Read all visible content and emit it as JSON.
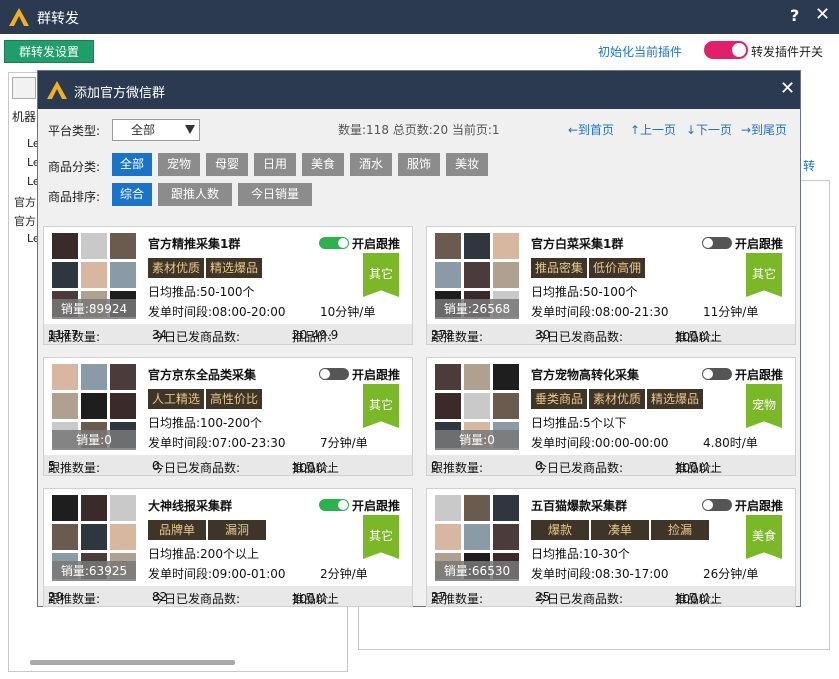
{
  "window": {
    "title": "群转发",
    "help": "?",
    "close": "✕"
  },
  "outer": {
    "settings_button": "群转发设置",
    "init_link": "初始化当前插件",
    "forward_switch_label": "转发插件开关",
    "forward_switch_on": true,
    "bg_tab": "机器",
    "bg_side_items": [
      "Le",
      "Le",
      "Le",
      "官方",
      "官方",
      "Le"
    ],
    "bg_right_link": "转"
  },
  "modal": {
    "title": "添加官方微信群",
    "close": "✕",
    "platform_label": "平台类型:",
    "platform_value": "全部",
    "stats": "数量:118 总页数:20 当前页:1",
    "nav": {
      "first": "←到首页",
      "prev": "↑上一页",
      "next": "↓下一页",
      "last": "→到尾页"
    },
    "category_label": "商品分类:",
    "categories": [
      "全部",
      "宠物",
      "母婴",
      "日用",
      "美食",
      "酒水",
      "服饰",
      "美妆"
    ],
    "sort_label": "商品排序:",
    "sorts": [
      "综合",
      "跟推人数",
      "今日销量"
    ]
  },
  "labels": {
    "follow": "开启跟推",
    "daily_prefix": "日均推品:",
    "time_prefix": "发单时间段:",
    "follow_count_prefix": "跟推数量:",
    "today_prefix": "今日已发商品数:",
    "price_prefix": "推品价:",
    "sales_prefix": "销量:"
  },
  "cards": [
    {
      "name": "官方精推采集1群",
      "enabled": true,
      "tags": [
        "素材优质",
        "精选爆品"
      ],
      "flag": "其它",
      "sales": "89924",
      "daily": "50-100个",
      "time": "08:00-20:00",
      "rate": "10分钟/单",
      "follow_count": "1177",
      "today": "34",
      "price": "20-49.9"
    },
    {
      "name": "官方白菜采集1群",
      "enabled": false,
      "tags": [
        "推品密集",
        "低价高佣"
      ],
      "flag": "其它",
      "sales": "26568",
      "daily": "50-100个",
      "time": "08:00-21:30",
      "rate": "11分钟/单",
      "follow_count": "272",
      "today": "30",
      "price": "100以上"
    },
    {
      "name": "官方京东全品类采集",
      "enabled": false,
      "tags": [
        "人工精选",
        "高性价比"
      ],
      "flag": "其它",
      "sales": "0",
      "daily": "100-200个",
      "time": "07:00-23:30",
      "rate": "7分钟/单",
      "follow_count": "5",
      "today": "0",
      "price": "100以上"
    },
    {
      "name": "官方宠物高转化采集",
      "enabled": false,
      "tags": [
        "垂类商品",
        "素材优质",
        "精选爆品"
      ],
      "flag": "宠物",
      "sales": "0",
      "daily": "5个以下",
      "time": "00:00-00:00",
      "rate": "4.80时/单",
      "follow_count": "0",
      "today": "0",
      "price": "100以上"
    },
    {
      "name": "大神线报采集群",
      "enabled": true,
      "tags": [
        "品牌单",
        "漏洞"
      ],
      "flag": "其它",
      "sales": "63925",
      "daily": "200个以上",
      "time": "09:00-01:00",
      "rate": "2分钟/单",
      "follow_count": "29",
      "today": "82",
      "price": "100以上"
    },
    {
      "name": "五百猫爆款采集群",
      "enabled": false,
      "tags": [
        "爆款",
        "凑单",
        "捡漏"
      ],
      "flag": "美食",
      "sales": "66530",
      "daily": "10-30个",
      "time": "08:30-17:00",
      "rate": "26分钟/单",
      "follow_count": "27",
      "today": "25",
      "price": "100以上"
    }
  ],
  "colors": {
    "title_bar": "#2b3a50",
    "accent_blue": "#1a73c8",
    "switch_pink": "#e0206a",
    "flag_green": "#7ab828",
    "tag_bg": "#3e3528",
    "tag_text": "#e8c789"
  }
}
